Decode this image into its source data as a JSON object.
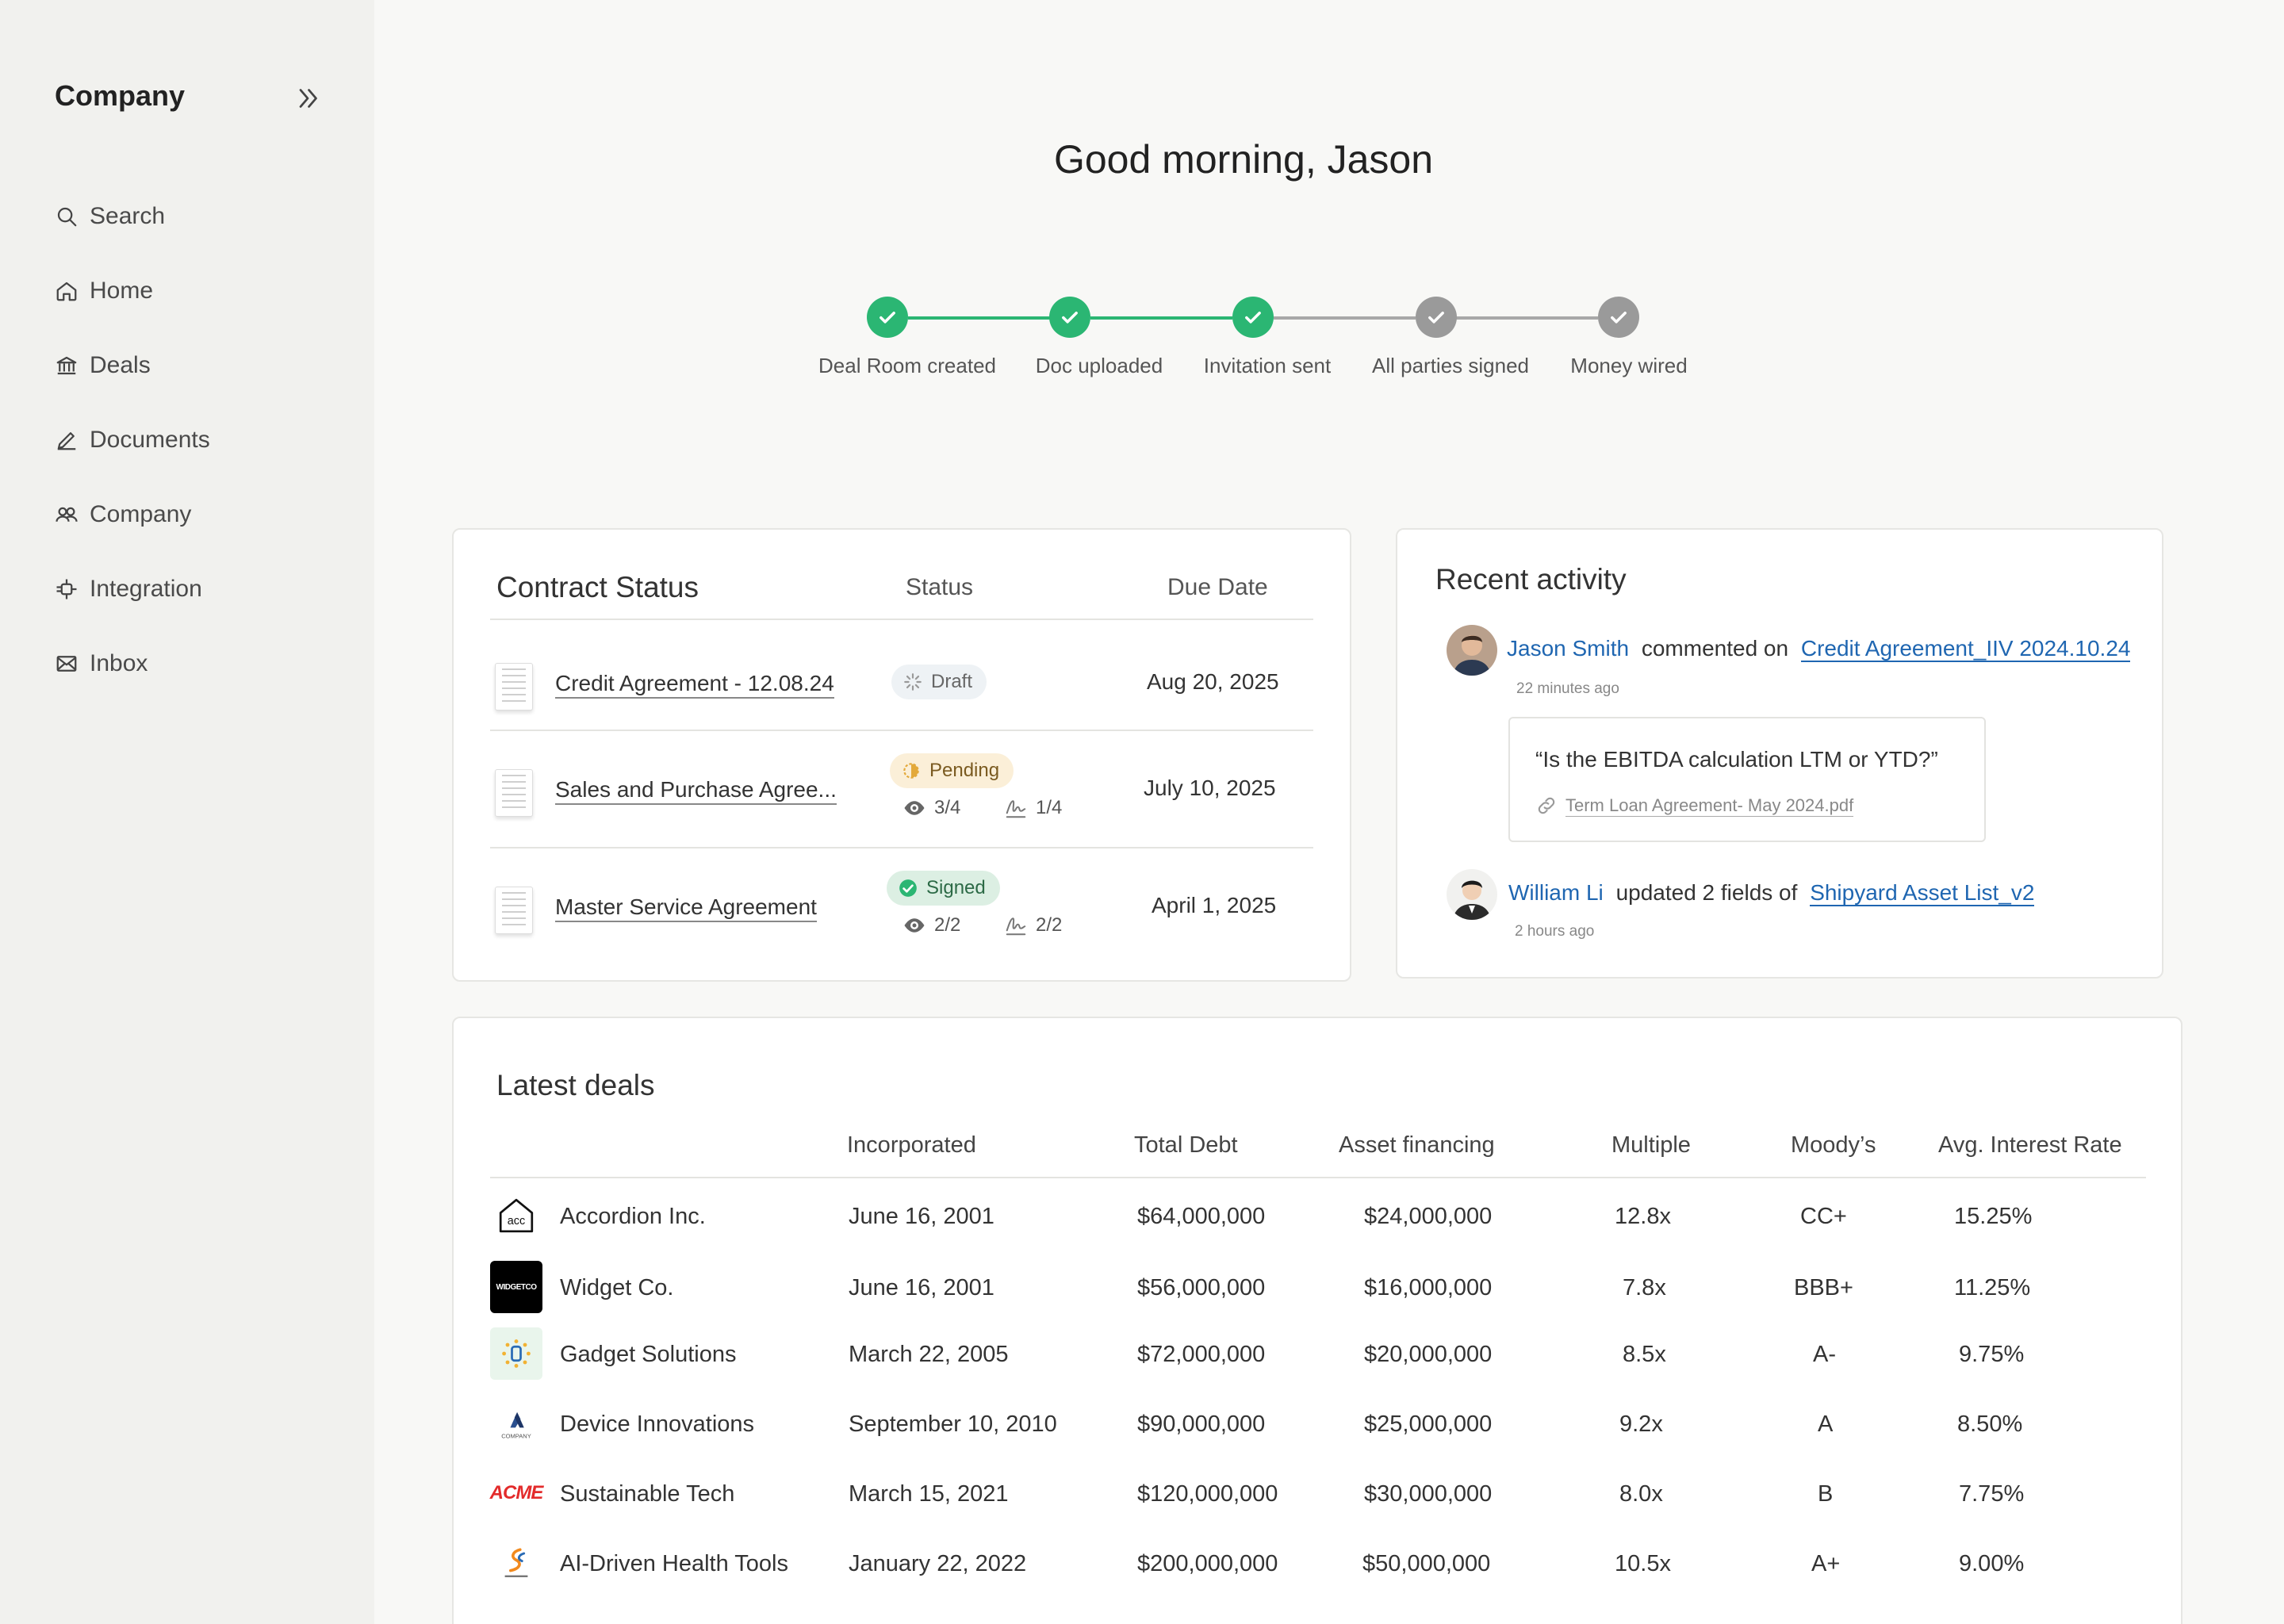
{
  "sidebar": {
    "brand": "Company",
    "items": [
      {
        "label": "Search",
        "icon": "search-icon"
      },
      {
        "label": "Home",
        "icon": "home-icon"
      },
      {
        "label": "Deals",
        "icon": "bank-icon"
      },
      {
        "label": "Documents",
        "icon": "pencil-icon"
      },
      {
        "label": "Company",
        "icon": "users-icon"
      },
      {
        "label": "Integration",
        "icon": "integration-icon"
      },
      {
        "label": "Inbox",
        "icon": "mail-icon"
      }
    ]
  },
  "greeting": "Good morning, Jason",
  "progress": {
    "steps": [
      {
        "label": "Deal Room created",
        "done": true
      },
      {
        "label": "Doc uploaded",
        "done": true
      },
      {
        "label": "Invitation sent",
        "done": true
      },
      {
        "label": "All parties signed",
        "done": false
      },
      {
        "label": "Money wired",
        "done": false
      }
    ]
  },
  "contracts": {
    "title": "Contract Status",
    "col_status": "Status",
    "col_due": "Due Date",
    "rows": [
      {
        "name": "Credit Agreement - 12.08.24",
        "status": "Draft",
        "views": "",
        "signs": "",
        "due": "Aug 20, 2025"
      },
      {
        "name": "Sales and Purchase Agree...",
        "status": "Pending",
        "views": "3/4",
        "signs": "1/4",
        "due": "July 10, 2025"
      },
      {
        "name": "Master Service Agreement",
        "status": "Signed",
        "views": "2/2",
        "signs": "2/2",
        "due": "April 1, 2025"
      }
    ]
  },
  "activity": {
    "title": "Recent activity",
    "items": [
      {
        "user": "Jason Smith",
        "action": "commented on",
        "target": "Credit Agreement_IIV 2024.10.24",
        "time": "22 minutes ago",
        "quote": "“Is the EBITDA calculation LTM or YTD?”",
        "attachment": "Term Loan Agreement- May 2024.pdf"
      },
      {
        "user": "William Li",
        "action": "updated 2 fields of",
        "target": "Shipyard Asset List_v2",
        "time": "2 hours ago"
      }
    ]
  },
  "deals": {
    "title": "Latest deals",
    "columns": [
      "Incorporated",
      "Total Debt",
      "Asset financing",
      "Multiple",
      "Moody’s",
      "Avg. Interest Rate"
    ],
    "rows": [
      {
        "name": "Accordion Inc.",
        "logo_text": "acc",
        "incorporated": "June 16, 2001",
        "debt": "$64,000,000",
        "asset": "$24,000,000",
        "multiple": "12.8x",
        "moodys": "CC+",
        "rate": "15.25%"
      },
      {
        "name": "Widget Co.",
        "logo_text": "WIDGETCO",
        "incorporated": "June 16, 2001",
        "debt": "$56,000,000",
        "asset": "$16,000,000",
        "multiple": "7.8x",
        "moodys": "BBB+",
        "rate": "11.25%"
      },
      {
        "name": "Gadget Solutions",
        "logo_text": "",
        "incorporated": "March 22, 2005",
        "debt": "$72,000,000",
        "asset": "$20,000,000",
        "multiple": "8.5x",
        "moodys": "A-",
        "rate": "9.75%"
      },
      {
        "name": "Device Innovations",
        "logo_text": "COMPANY",
        "incorporated": "September 10, 2010",
        "debt": "$90,000,000",
        "asset": "$25,000,000",
        "multiple": "9.2x",
        "moodys": "A",
        "rate": "8.50%"
      },
      {
        "name": "Sustainable Tech",
        "logo_text": "ACME",
        "incorporated": "March 15, 2021",
        "debt": "$120,000,000",
        "asset": "$30,000,000",
        "multiple": "8.0x",
        "moodys": "B",
        "rate": "7.75%"
      },
      {
        "name": "AI-Driven Health Tools",
        "logo_text": "",
        "incorporated": "January 22, 2022",
        "debt": "$200,000,000",
        "asset": "$50,000,000",
        "multiple": "10.5x",
        "moodys": "A+",
        "rate": "9.00%"
      }
    ]
  },
  "colors": {
    "step_done": "#2bb673",
    "step_todo": "#9a9a9a",
    "link": "#1f66b1"
  }
}
